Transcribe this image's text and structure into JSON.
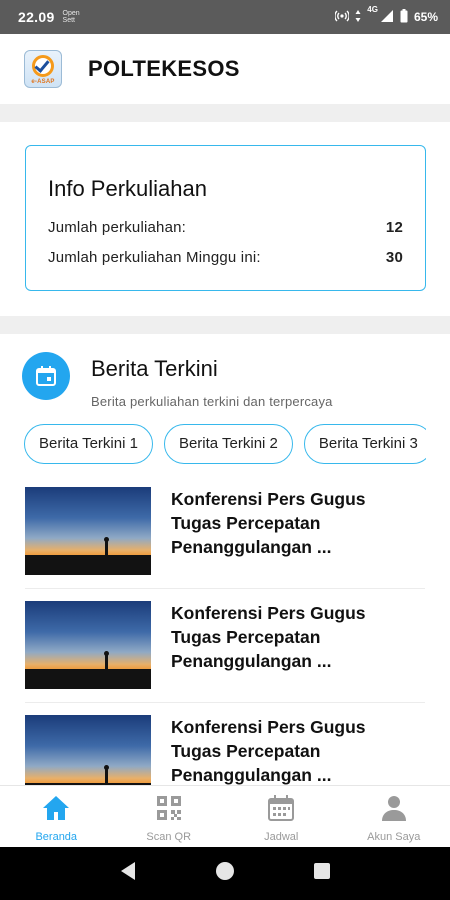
{
  "status_bar": {
    "time": "22.09",
    "notification_text": "Open Sett",
    "network": "4G",
    "battery": "65%"
  },
  "app": {
    "title": "POLTEKESOS",
    "logo_text": "e-ASAP"
  },
  "info_card": {
    "title": "Info Perkuliahan",
    "rows": [
      {
        "label": "Jumlah perkuliahan:",
        "value": "12"
      },
      {
        "label": "Jumlah perkuliahan Minggu ini:",
        "value": "30"
      }
    ]
  },
  "news": {
    "title": "Berita Terkini",
    "subtitle": "Berita perkuliahan terkini dan terpercaya",
    "chips": [
      "Berita Terkini 1",
      "Berita Terkini 2",
      "Berita Terkini 3"
    ],
    "items": [
      {
        "line1": "Konferensi Pers Gugus",
        "line2": "Tugas Percepatan",
        "line3": "Penanggulangan ..."
      },
      {
        "line1": "Konferensi Pers Gugus",
        "line2": "Tugas Percepatan",
        "line3": "Penanggulangan ..."
      },
      {
        "line1": "Konferensi Pers Gugus",
        "line2": "Tugas Percepatan",
        "line3": "Penanggulangan ..."
      }
    ]
  },
  "bottom_nav": {
    "items": [
      {
        "label": "Beranda",
        "icon": "home-icon",
        "active": true
      },
      {
        "label": "Scan QR",
        "icon": "qr-code-icon",
        "active": false
      },
      {
        "label": "Jadwal",
        "icon": "calendar-icon",
        "active": false
      },
      {
        "label": "Akun Saya",
        "icon": "person-icon",
        "active": false
      }
    ]
  },
  "colors": {
    "accent": "#23a6ef",
    "card_border": "#37b8ec",
    "status_bar": "#5b5b5b",
    "inactive": "#9a9a9a"
  }
}
